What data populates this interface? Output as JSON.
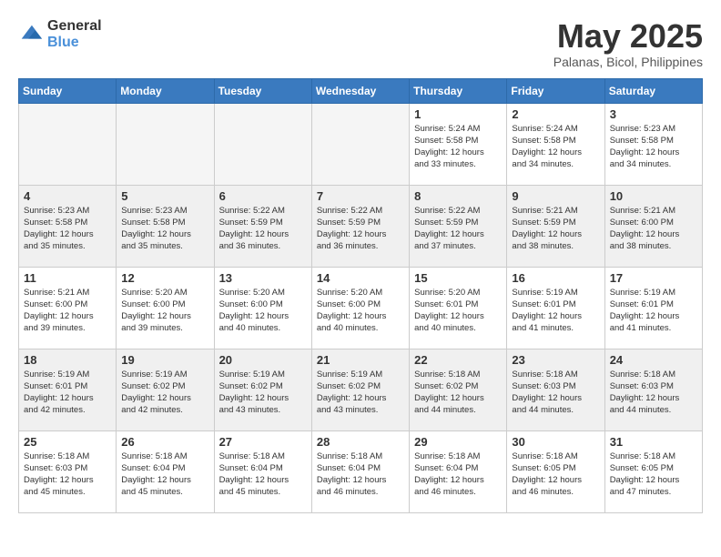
{
  "header": {
    "logo_general": "General",
    "logo_blue": "Blue",
    "title": "May 2025",
    "subtitle": "Palanas, Bicol, Philippines"
  },
  "weekdays": [
    "Sunday",
    "Monday",
    "Tuesday",
    "Wednesday",
    "Thursday",
    "Friday",
    "Saturday"
  ],
  "weeks": [
    [
      {
        "day": "",
        "info": ""
      },
      {
        "day": "",
        "info": ""
      },
      {
        "day": "",
        "info": ""
      },
      {
        "day": "",
        "info": ""
      },
      {
        "day": "1",
        "info": "Sunrise: 5:24 AM\nSunset: 5:58 PM\nDaylight: 12 hours\nand 33 minutes."
      },
      {
        "day": "2",
        "info": "Sunrise: 5:24 AM\nSunset: 5:58 PM\nDaylight: 12 hours\nand 34 minutes."
      },
      {
        "day": "3",
        "info": "Sunrise: 5:23 AM\nSunset: 5:58 PM\nDaylight: 12 hours\nand 34 minutes."
      }
    ],
    [
      {
        "day": "4",
        "info": "Sunrise: 5:23 AM\nSunset: 5:58 PM\nDaylight: 12 hours\nand 35 minutes."
      },
      {
        "day": "5",
        "info": "Sunrise: 5:23 AM\nSunset: 5:58 PM\nDaylight: 12 hours\nand 35 minutes."
      },
      {
        "day": "6",
        "info": "Sunrise: 5:22 AM\nSunset: 5:59 PM\nDaylight: 12 hours\nand 36 minutes."
      },
      {
        "day": "7",
        "info": "Sunrise: 5:22 AM\nSunset: 5:59 PM\nDaylight: 12 hours\nand 36 minutes."
      },
      {
        "day": "8",
        "info": "Sunrise: 5:22 AM\nSunset: 5:59 PM\nDaylight: 12 hours\nand 37 minutes."
      },
      {
        "day": "9",
        "info": "Sunrise: 5:21 AM\nSunset: 5:59 PM\nDaylight: 12 hours\nand 38 minutes."
      },
      {
        "day": "10",
        "info": "Sunrise: 5:21 AM\nSunset: 6:00 PM\nDaylight: 12 hours\nand 38 minutes."
      }
    ],
    [
      {
        "day": "11",
        "info": "Sunrise: 5:21 AM\nSunset: 6:00 PM\nDaylight: 12 hours\nand 39 minutes."
      },
      {
        "day": "12",
        "info": "Sunrise: 5:20 AM\nSunset: 6:00 PM\nDaylight: 12 hours\nand 39 minutes."
      },
      {
        "day": "13",
        "info": "Sunrise: 5:20 AM\nSunset: 6:00 PM\nDaylight: 12 hours\nand 40 minutes."
      },
      {
        "day": "14",
        "info": "Sunrise: 5:20 AM\nSunset: 6:00 PM\nDaylight: 12 hours\nand 40 minutes."
      },
      {
        "day": "15",
        "info": "Sunrise: 5:20 AM\nSunset: 6:01 PM\nDaylight: 12 hours\nand 40 minutes."
      },
      {
        "day": "16",
        "info": "Sunrise: 5:19 AM\nSunset: 6:01 PM\nDaylight: 12 hours\nand 41 minutes."
      },
      {
        "day": "17",
        "info": "Sunrise: 5:19 AM\nSunset: 6:01 PM\nDaylight: 12 hours\nand 41 minutes."
      }
    ],
    [
      {
        "day": "18",
        "info": "Sunrise: 5:19 AM\nSunset: 6:01 PM\nDaylight: 12 hours\nand 42 minutes."
      },
      {
        "day": "19",
        "info": "Sunrise: 5:19 AM\nSunset: 6:02 PM\nDaylight: 12 hours\nand 42 minutes."
      },
      {
        "day": "20",
        "info": "Sunrise: 5:19 AM\nSunset: 6:02 PM\nDaylight: 12 hours\nand 43 minutes."
      },
      {
        "day": "21",
        "info": "Sunrise: 5:19 AM\nSunset: 6:02 PM\nDaylight: 12 hours\nand 43 minutes."
      },
      {
        "day": "22",
        "info": "Sunrise: 5:18 AM\nSunset: 6:02 PM\nDaylight: 12 hours\nand 44 minutes."
      },
      {
        "day": "23",
        "info": "Sunrise: 5:18 AM\nSunset: 6:03 PM\nDaylight: 12 hours\nand 44 minutes."
      },
      {
        "day": "24",
        "info": "Sunrise: 5:18 AM\nSunset: 6:03 PM\nDaylight: 12 hours\nand 44 minutes."
      }
    ],
    [
      {
        "day": "25",
        "info": "Sunrise: 5:18 AM\nSunset: 6:03 PM\nDaylight: 12 hours\nand 45 minutes."
      },
      {
        "day": "26",
        "info": "Sunrise: 5:18 AM\nSunset: 6:04 PM\nDaylight: 12 hours\nand 45 minutes."
      },
      {
        "day": "27",
        "info": "Sunrise: 5:18 AM\nSunset: 6:04 PM\nDaylight: 12 hours\nand 45 minutes."
      },
      {
        "day": "28",
        "info": "Sunrise: 5:18 AM\nSunset: 6:04 PM\nDaylight: 12 hours\nand 46 minutes."
      },
      {
        "day": "29",
        "info": "Sunrise: 5:18 AM\nSunset: 6:04 PM\nDaylight: 12 hours\nand 46 minutes."
      },
      {
        "day": "30",
        "info": "Sunrise: 5:18 AM\nSunset: 6:05 PM\nDaylight: 12 hours\nand 46 minutes."
      },
      {
        "day": "31",
        "info": "Sunrise: 5:18 AM\nSunset: 6:05 PM\nDaylight: 12 hours\nand 47 minutes."
      }
    ]
  ]
}
